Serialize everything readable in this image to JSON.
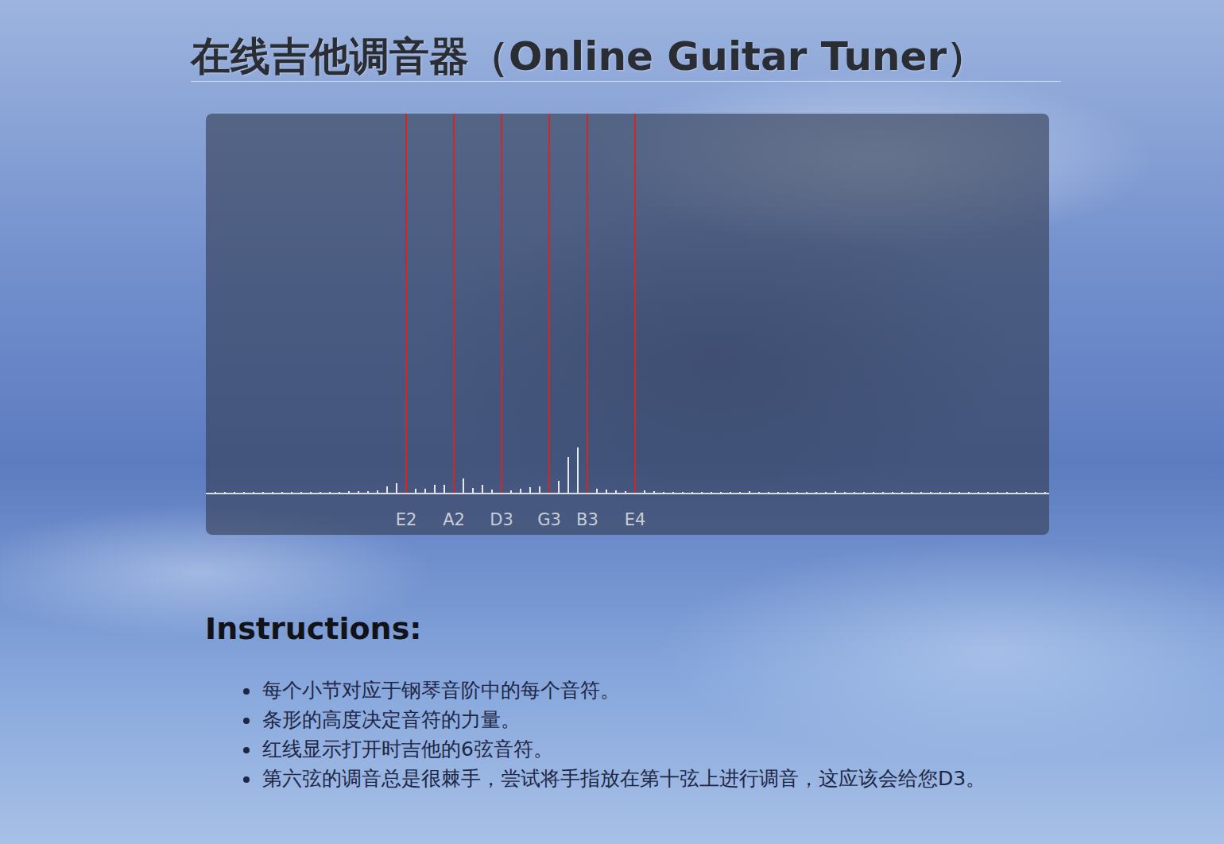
{
  "title": "在线吉他调音器（Online Guitar Tuner）",
  "tuner": {
    "strings": [
      {
        "label": "E2",
        "semitone": 20
      },
      {
        "label": "A2",
        "semitone": 25
      },
      {
        "label": "D3",
        "semitone": 30
      },
      {
        "label": "G3",
        "semitone": 35
      },
      {
        "label": "B3",
        "semitone": 39
      },
      {
        "label": "E4",
        "semitone": 44
      }
    ],
    "values": [
      1,
      1,
      1,
      1,
      1,
      1,
      1,
      1,
      1,
      1,
      1,
      1,
      1,
      1,
      2,
      2,
      2,
      3,
      8,
      12,
      10,
      5,
      5,
      10,
      10,
      8,
      18,
      6,
      10,
      4,
      3,
      3,
      5,
      7,
      8,
      6,
      15,
      45,
      57,
      15,
      5,
      4,
      3,
      2,
      2,
      3,
      2,
      1,
      1,
      1,
      1,
      1,
      1,
      1,
      1,
      1,
      2,
      1,
      1,
      1,
      1,
      1,
      1,
      1,
      1,
      2,
      1,
      1,
      1,
      1,
      1,
      1,
      1,
      1,
      1,
      1,
      1,
      1,
      1,
      1,
      1,
      1,
      1,
      1,
      1,
      1,
      1,
      1
    ]
  },
  "instructions": {
    "heading": "Instructions:",
    "items": [
      "每个小节对应于钢琴音阶中的每个音符。",
      "条形的高度决定音符的力量。",
      "红线显示打开时吉他的6弦音符。",
      "第六弦的调音总是很棘手，尝试将手指放在第十弦上进行调音，这应该会给您D3。"
    ]
  }
}
